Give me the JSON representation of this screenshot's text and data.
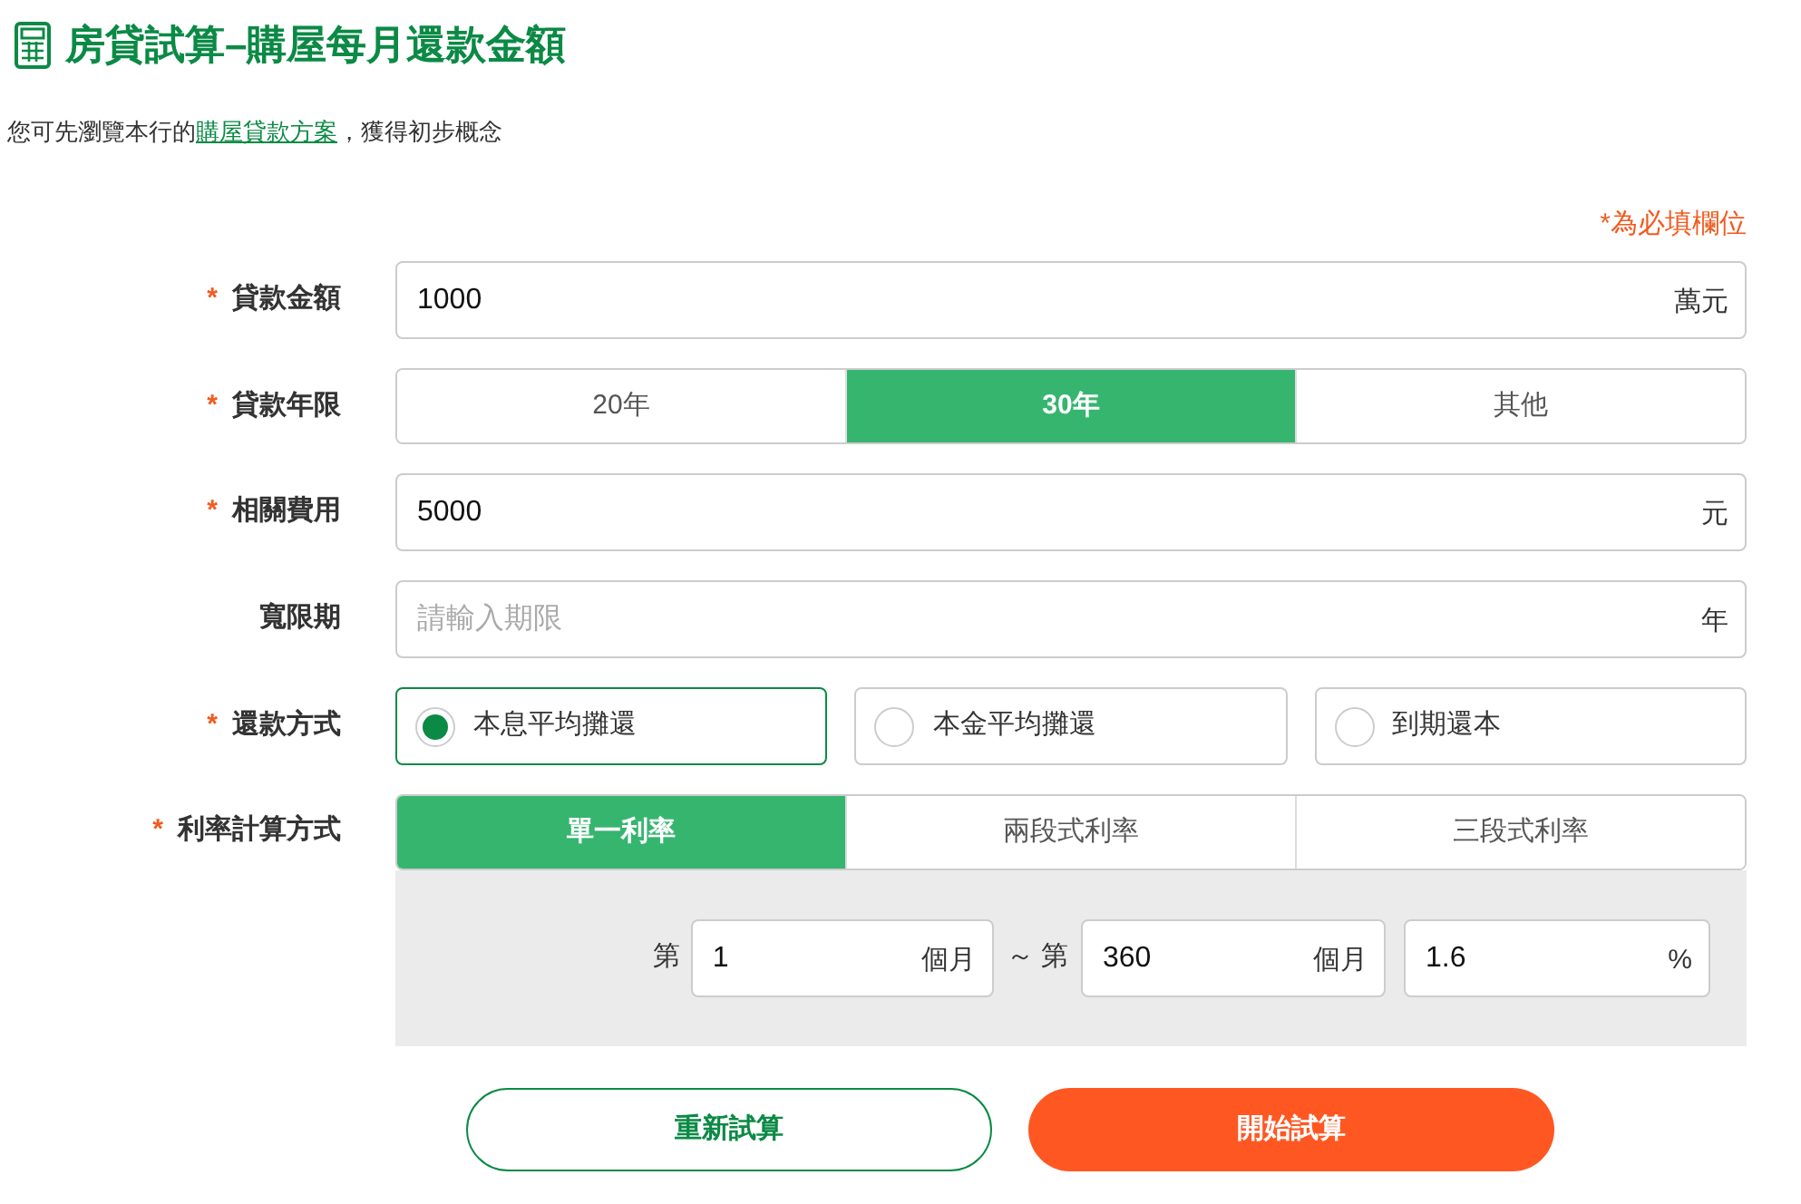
{
  "title": "房貸試算–購屋每月還款金額",
  "intro": {
    "before": "您可先瀏覽本行的",
    "link": "購屋貸款方案",
    "after": "，獲得初步概念"
  },
  "required_note": "*為必填欄位",
  "form": [
    {
      "kind": "input",
      "label": "貸款金額",
      "asterisk": "*",
      "value": "1000",
      "unit": "萬元"
    },
    {
      "kind": "segments",
      "label": "貸款年限",
      "asterisk": "*",
      "options": [
        {
          "label": "20年",
          "selected": false
        },
        {
          "label": "30年",
          "selected": true
        },
        {
          "label": "其他",
          "selected": false
        }
      ]
    },
    {
      "kind": "input",
      "label": "相關費用",
      "asterisk": "*",
      "value": "5000",
      "unit": "元"
    },
    {
      "kind": "input",
      "label": "寬限期",
      "placeholder": "請輸入期限",
      "unit": "年"
    },
    {
      "kind": "radios",
      "label": "還款方式",
      "asterisk": "*",
      "options": [
        {
          "label": "本息平均攤還",
          "selected": true
        },
        {
          "label": "本金平均攤還",
          "selected": false
        },
        {
          "label": "到期還本",
          "selected": false
        }
      ]
    },
    {
      "kind": "rate",
      "label": "利率計算方式",
      "asterisk": "*",
      "options": [
        {
          "label": "單一利率",
          "selected": true
        },
        {
          "label": "兩段式利率",
          "selected": false
        },
        {
          "label": "三段式利率",
          "selected": false
        }
      ],
      "panel": {
        "from_prefix": "第",
        "from_value": "1",
        "from_unit": "個月",
        "to_prefix": "～ 第",
        "to_value": "360",
        "to_unit": "個月",
        "rate_value": "1.6",
        "rate_unit": "%"
      }
    }
  ],
  "buttons": [
    {
      "label": "重新試算",
      "kind": "outline"
    },
    {
      "label": "開始試算",
      "kind": "primary"
    }
  ]
}
